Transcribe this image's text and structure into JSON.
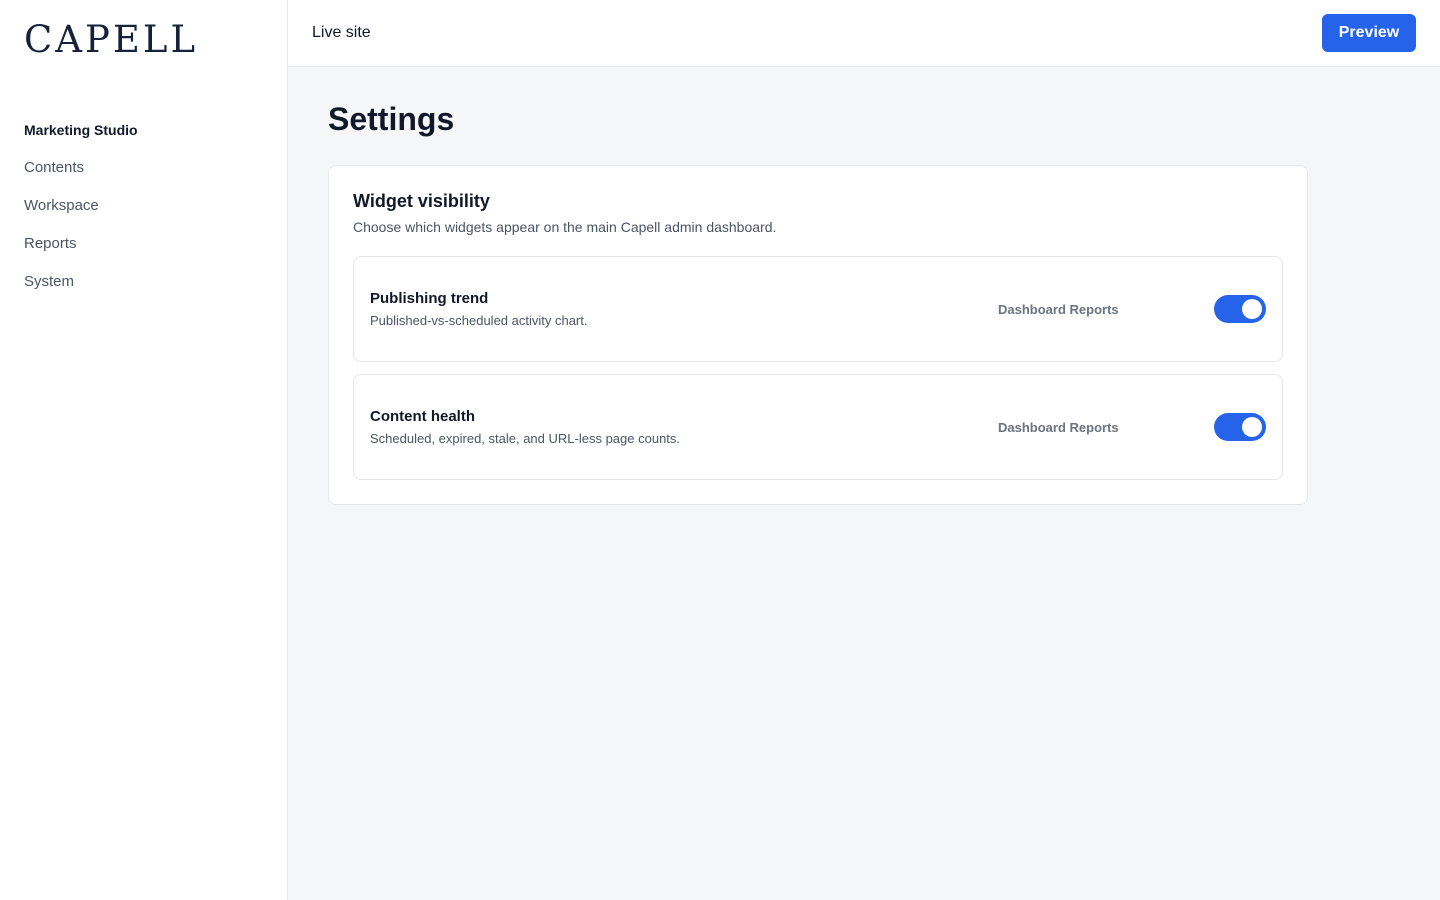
{
  "brand": {
    "logo": "CAPELL"
  },
  "sidebar": {
    "section": "Marketing Studio",
    "items": [
      {
        "label": "Contents"
      },
      {
        "label": "Workspace"
      },
      {
        "label": "Reports"
      },
      {
        "label": "System"
      }
    ]
  },
  "topbar": {
    "live_site": "Live site",
    "preview_label": "Preview"
  },
  "page": {
    "title": "Settings"
  },
  "widget_visibility": {
    "title": "Widget visibility",
    "description": "Choose which widgets appear on the main Capell admin dashboard.",
    "widgets": [
      {
        "name": "Publishing trend",
        "description": "Published-vs-scheduled activity chart.",
        "tag": "Dashboard Reports",
        "enabled": true
      },
      {
        "name": "Content health",
        "description": "Scheduled, expired, stale, and URL-less page counts.",
        "tag": "Dashboard Reports",
        "enabled": true
      }
    ]
  },
  "colors": {
    "accent": "#2563eb",
    "logo": "#16213a"
  }
}
